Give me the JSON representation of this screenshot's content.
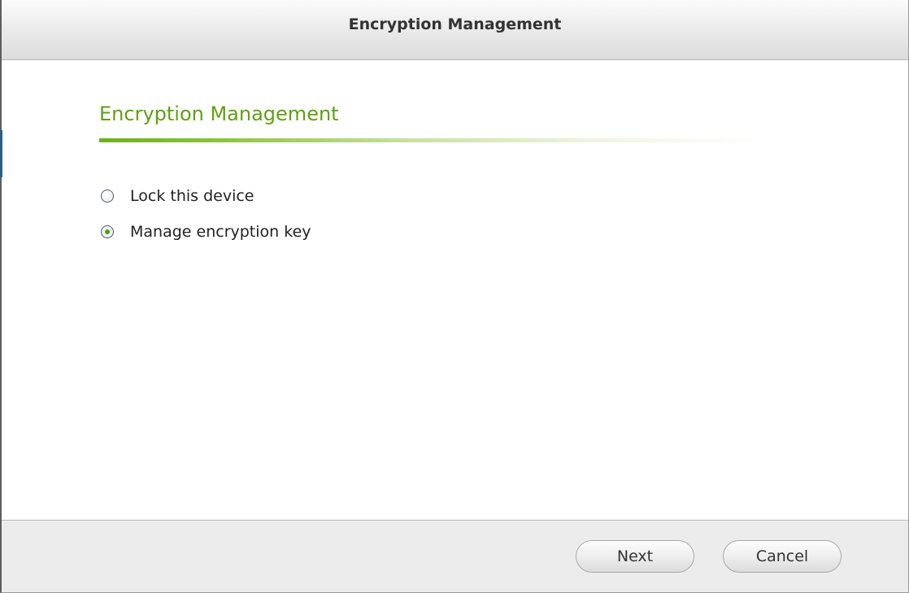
{
  "window": {
    "title": "Encryption Management"
  },
  "section": {
    "title": "Encryption Management"
  },
  "options": [
    {
      "label": "Lock this device",
      "selected": false
    },
    {
      "label": "Manage encryption key",
      "selected": true
    }
  ],
  "buttons": {
    "next_label": "Next",
    "cancel_label": "Cancel"
  },
  "colors": {
    "accent_green": "#5fa012",
    "radio_dot": "#3fa61b"
  }
}
